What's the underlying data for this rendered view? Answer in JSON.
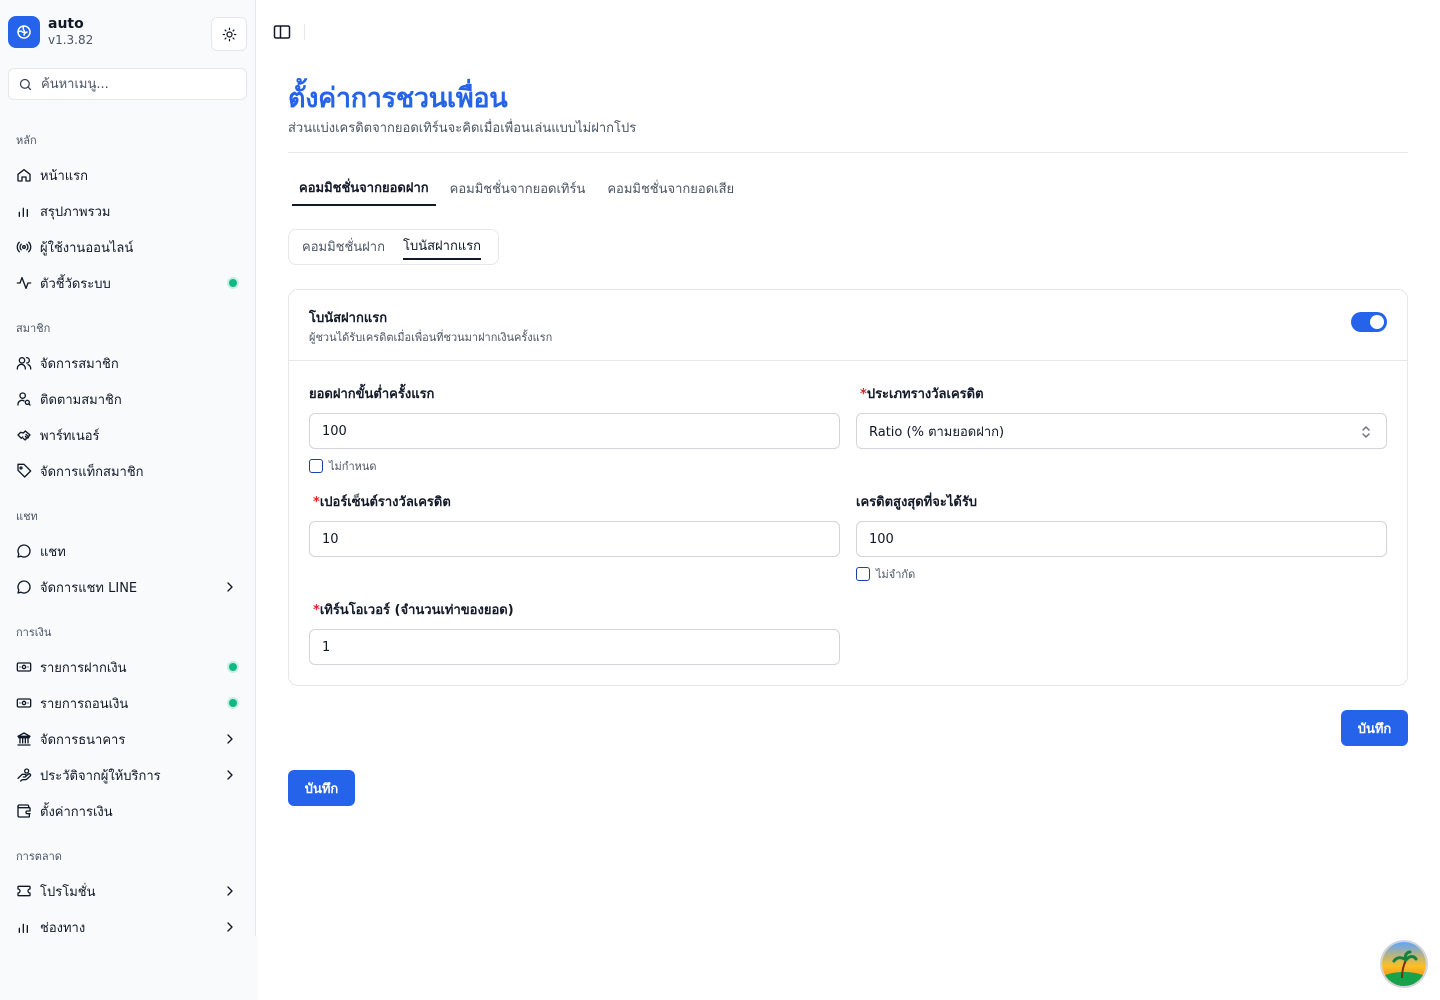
{
  "app": {
    "name": "auto",
    "version": "v1.3.82"
  },
  "search": {
    "placeholder": "ค้นหาเมนู..."
  },
  "sidebar": {
    "groups": [
      {
        "label": "หลัก",
        "items": [
          {
            "label": "หน้าแรก",
            "icon": "home-icon"
          },
          {
            "label": "สรุปภาพรวม",
            "icon": "bar-chart-icon"
          },
          {
            "label": "ผู้ใช้งานออนไลน์",
            "icon": "radio-icon"
          },
          {
            "label": "ตัวชี้วัดระบบ",
            "icon": "activity-icon",
            "badge": "online-dot"
          }
        ]
      },
      {
        "label": "สมาชิก",
        "items": [
          {
            "label": "จัดการสมาชิก",
            "icon": "users-icon"
          },
          {
            "label": "ติดตามสมาชิก",
            "icon": "user-search-icon"
          },
          {
            "label": "พาร์ทเนอร์",
            "icon": "handshake-icon"
          },
          {
            "label": "จัดการแท็กสมาชิก",
            "icon": "tag-icon"
          }
        ]
      },
      {
        "label": "แชท",
        "items": [
          {
            "label": "แชท",
            "icon": "message-icon"
          },
          {
            "label": "จัดการแชท LINE",
            "icon": "message-icon",
            "expandable": true
          }
        ]
      },
      {
        "label": "การเงิน",
        "items": [
          {
            "label": "รายการฝากเงิน",
            "icon": "money-in-icon",
            "badge": "online-dot"
          },
          {
            "label": "รายการถอนเงิน",
            "icon": "money-out-icon",
            "badge": "online-dot"
          },
          {
            "label": "จัดการธนาคาร",
            "icon": "bank-icon",
            "expandable": true
          },
          {
            "label": "ประวัติจากผู้ให้บริการ",
            "icon": "hand-coins-icon",
            "expandable": true
          },
          {
            "label": "ตั้งค่าการเงิน",
            "icon": "wallet-icon"
          }
        ]
      },
      {
        "label": "การตลาด",
        "items": [
          {
            "label": "โปรโมชั่น",
            "icon": "ticket-icon",
            "expandable": true
          },
          {
            "label": "ช่องทาง",
            "icon": "bar-chart-icon",
            "expandable": true
          }
        ]
      }
    ]
  },
  "page": {
    "title": "ตั้งค่าการชวนเพื่อน",
    "subtitle": "ส่วนแบ่งเครดิตจากยอดเทิร์นจะคิดเมื่อเพื่อนเล่นแบบไม่ฝากโปร"
  },
  "tabs": [
    {
      "label": "คอมมิชชั่นจากยอดฝาก",
      "active": true
    },
    {
      "label": "คอมมิชชั่นจากยอดเทิร์น",
      "active": false
    },
    {
      "label": "คอมมิชชั่นจากยอดเสีย",
      "active": false
    }
  ],
  "subtabs": [
    {
      "label": "คอมมิชชั่นฝาก",
      "active": false
    },
    {
      "label": "โบนัสฝากแรก",
      "active": true
    }
  ],
  "card": {
    "title": "โบนัสฝากแรก",
    "description": "ผู้ชวนได้รับเครดิตเมื่อเพื่อนที่ชวนมาฝากเงินครั้งแรก",
    "enabled": true,
    "fields": {
      "min_deposit": {
        "label": "ยอดฝากขั้นต่ำครั้งแรก",
        "value": "100",
        "required": false,
        "checkbox_label": "ไม่กำหนด",
        "checked": false
      },
      "reward_type": {
        "label": "ประเภทรางวัลเครดิต",
        "value": "Ratio (% ตามยอดฝาก)",
        "required": true
      },
      "reward_percent": {
        "label": "เปอร์เซ็นต์รางวัลเครดิต",
        "value": "10",
        "required": true
      },
      "max_credit": {
        "label": "เครดิตสูงสุดที่จะได้รับ",
        "value": "100",
        "required": false,
        "checkbox_label": "ไม่จำกัด",
        "checked": false
      },
      "turnover": {
        "label": "เทิร์นโอเวอร์ (จำนวนเท่าของยอด)",
        "value": "1",
        "required": true
      }
    },
    "required_mark": "*"
  },
  "actions": {
    "save_inner": "บันทึก",
    "save_outer": "บันทึก"
  },
  "colors": {
    "primary": "#2563eb",
    "online": "#10b981",
    "required": "#dc2626"
  }
}
